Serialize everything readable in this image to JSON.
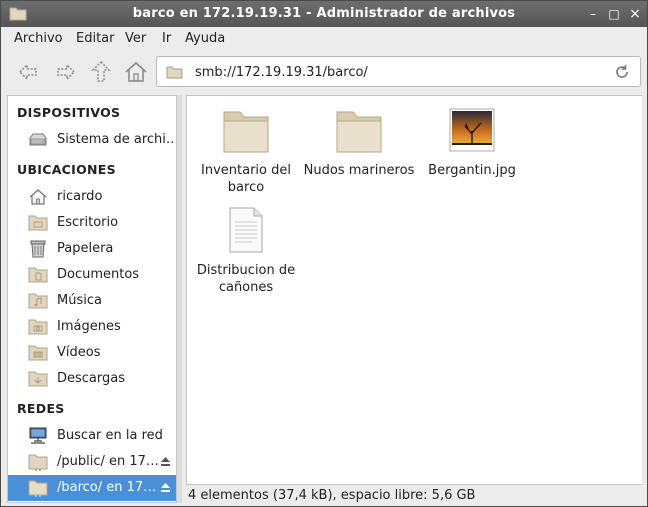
{
  "window": {
    "title": "barco en 172.19.19.31 - Administrador de archivos",
    "minimize": "–",
    "maximize": "□",
    "close": "×"
  },
  "menubar": {
    "items": [
      "Archivo",
      "Editar",
      "Ver",
      "Ir",
      "Ayuda"
    ]
  },
  "toolbar": {
    "buttons": [
      "back-icon",
      "forward-icon",
      "up-icon",
      "home-icon"
    ],
    "location": "smb://172.19.19.31/barco/"
  },
  "sidebar": {
    "sections": [
      {
        "title": "DISPOSITIVOS",
        "items": [
          {
            "label": "Sistema de archi…",
            "icon": "harddrive-icon"
          }
        ]
      },
      {
        "title": "UBICACIONES",
        "items": [
          {
            "label": "ricardo",
            "icon": "home-icon"
          },
          {
            "label": "Escritorio",
            "icon": "folder-icon"
          },
          {
            "label": "Papelera",
            "icon": "trash-icon"
          },
          {
            "label": "Documentos",
            "icon": "folder-icon"
          },
          {
            "label": "Música",
            "icon": "folder-icon"
          },
          {
            "label": "Imágenes",
            "icon": "folder-icon"
          },
          {
            "label": "Vídeos",
            "icon": "folder-icon"
          },
          {
            "label": "Descargas",
            "icon": "folder-icon"
          }
        ]
      },
      {
        "title": "REDES",
        "items": [
          {
            "label": "Buscar en la red",
            "icon": "network-icon"
          },
          {
            "label": "/public/ en 17…",
            "icon": "folder-icon",
            "eject": true
          },
          {
            "label": "/barco/ en 17…",
            "icon": "folder-icon",
            "eject": true,
            "selected": true
          }
        ]
      }
    ]
  },
  "files": [
    {
      "name": "Inventario del barco",
      "type": "folder"
    },
    {
      "name": "Nudos marineros",
      "type": "folder"
    },
    {
      "name": "Bergantin.jpg",
      "type": "image"
    },
    {
      "name": "Distribucion de cañones",
      "type": "document"
    }
  ],
  "status": "4 elementos (37,4 kB), espacio libre: 5,6 GB",
  "colors": {
    "selection": "#4a90d9",
    "titlebar": "#5e5e5e"
  }
}
